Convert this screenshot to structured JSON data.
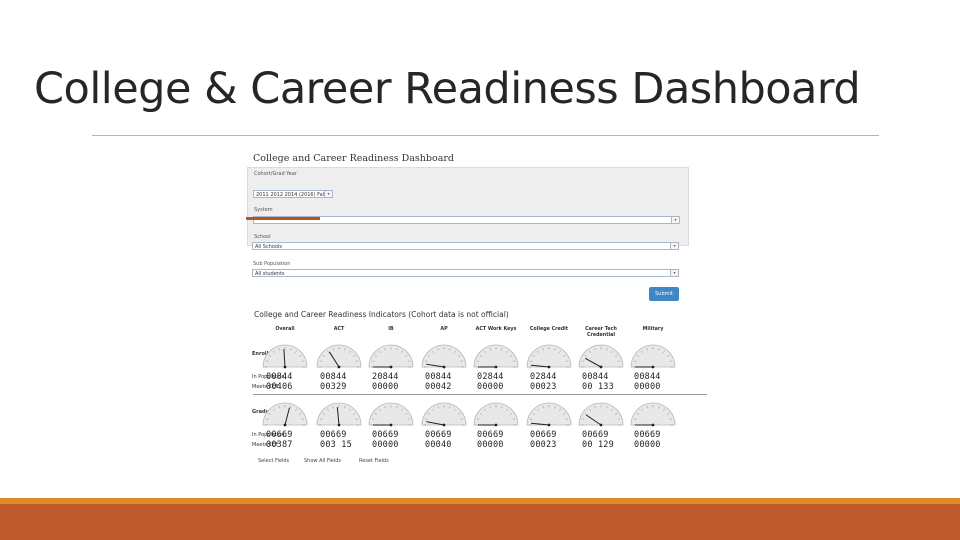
{
  "slide": {
    "title": "College & Career Readiness Dashboard"
  },
  "colors": {
    "footer_bar": "#bf5a2c",
    "footer_thin": "#e08a2b",
    "submit": "#3f87c9",
    "needle": "#222222"
  },
  "dashboard": {
    "title": "College and Career Readiness Dashboard",
    "form": {
      "cohort_label": "Cohort/Grad Year",
      "cohort_value": "2011 2012 2014 (2016) Fall",
      "system_label": "System",
      "system_value": "",
      "school_label": "School",
      "school_value": "All Schools",
      "subpop_label": "Sub Population",
      "subpop_value": "All students",
      "submit_label": "Submit"
    },
    "indicators_title": "College and Career Readiness Indicators (Cohort data is not official)",
    "columns": [
      "Overall",
      "ACT",
      "IB",
      "AP",
      "ACT Work Keys",
      "College Credit",
      "Career Tech Credential",
      "Military"
    ],
    "sections": [
      {
        "label": "Enrollment",
        "row1_label": "In Population",
        "row2_label": "Meets CCF",
        "row1": [
          "00844",
          "00844",
          "20844",
          "00844",
          "02844",
          "02844",
          "00844",
          "00844"
        ],
        "row2": [
          "00406",
          "00329",
          "00000",
          "00042",
          "00000",
          "00023",
          "00 133",
          "00000"
        ],
        "levels": [
          0.48,
          0.32,
          0.0,
          0.05,
          0.0,
          0.03,
          0.16,
          0.0
        ]
      },
      {
        "label": "Graduates",
        "row1_label": "In Population",
        "row2_label": "Meets CCF",
        "row1": [
          "00669",
          "00669",
          "00669",
          "00669",
          "00669",
          "00669",
          "00669",
          "00669"
        ],
        "row2": [
          "00387",
          "003 15",
          "00000",
          "00040",
          "00000",
          "00023",
          "00 129",
          "00000"
        ],
        "levels": [
          0.58,
          0.47,
          0.0,
          0.06,
          0.0,
          0.03,
          0.19,
          0.0
        ]
      }
    ],
    "bottom_links": [
      "Select Fields",
      "Show All Fields",
      "Reset Fields"
    ]
  }
}
